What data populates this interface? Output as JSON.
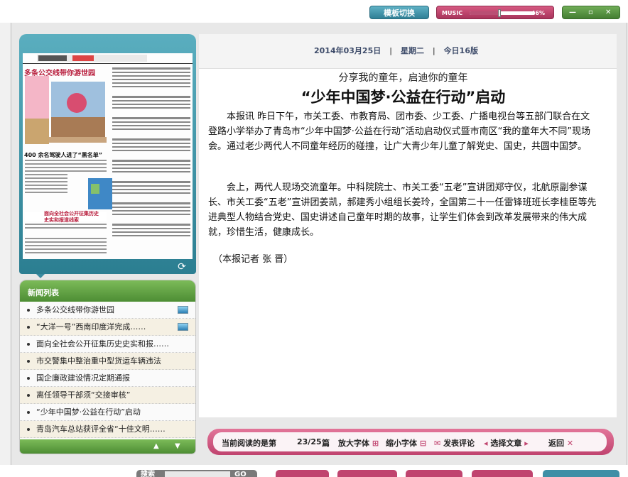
{
  "toolbar": {
    "template_switch": "模板切换",
    "music_label": "MUSIC",
    "music_volume_percent": 46,
    "music_value_text": "46%",
    "window_controls": [
      "—",
      "▫",
      "✕"
    ]
  },
  "paper": {
    "headline_1": "多条公交线带你游世园",
    "headline_2": "400 余名驾驶人进了“黑名单”",
    "headline_3": "面向全社会公开征集历史史实和报道线索",
    "refresh_icon": "refresh-icon"
  },
  "news_list": {
    "header": "新闻列表",
    "items": [
      {
        "title": "多条公交线带你游世园",
        "has_pic": true
      },
      {
        "title": "“大洋一号”西南印度洋完成……",
        "has_pic": true
      },
      {
        "title": "面向全社会公开征集历史史实和报……",
        "has_pic": false
      },
      {
        "title": "市交警集中整治重中型货运车辆违法",
        "has_pic": false
      },
      {
        "title": "国企廉政建设情况定期通报",
        "has_pic": false
      },
      {
        "title": "离任领导干部须“交接审核”",
        "has_pic": false
      },
      {
        "title": "“少年中国梦·公益在行动”启动",
        "has_pic": false
      },
      {
        "title": "青岛汽车总站获评全省“十佳文明……",
        "has_pic": false
      }
    ],
    "up_icon": "▲",
    "down_icon": "▼"
  },
  "article": {
    "date": "2014年03月25日",
    "weekday": "星期二",
    "edition": "今日16版",
    "subtitle": "分享我的童年，启迪你的童年",
    "title": "“少年中国梦·公益在行动”启动",
    "paragraph_1": "本报讯 昨日下午，市关工委、市教育局、团市委、少工委、广播电视台等五部门联合在文登路小学举办了青岛市“少年中国梦·公益在行动”活动启动仪式暨市南区“我的童年大不同”现场会。通过老少两代人不同童年经历的碰撞，让广大青少年儿童了解党史、国史，共圆中国梦。",
    "paragraph_2": "会上，两代人现场交流童年。中科院院士、市关工委“五老”宣讲团郑守仪，北航原副参谋长、市关工委“五老”宣讲团姜凯，郝建秀小组组长姜玲，全国第二十一任雷锋班班长李桂臣等先进典型人物结合党史、国史讲述自己童年时期的故事，让学生们体会到改革发展带来的伟大成就，珍惜生活，健康成长。",
    "reporter": "（本报记者 张 晋）"
  },
  "action_bar": {
    "reading_label": "当前阅读的是第",
    "position": "23/25",
    "unit": "篇",
    "enlarge": "放大字体",
    "shrink": "缩小字体",
    "comment": "发表评论",
    "select": "选择文章",
    "back": "返回"
  },
  "bottom_nav": {
    "search_label": "搜索",
    "go": "GO"
  },
  "colors": {
    "teal": "#2f7f95",
    "green": "#4d8d34",
    "pink": "#c0446f"
  }
}
